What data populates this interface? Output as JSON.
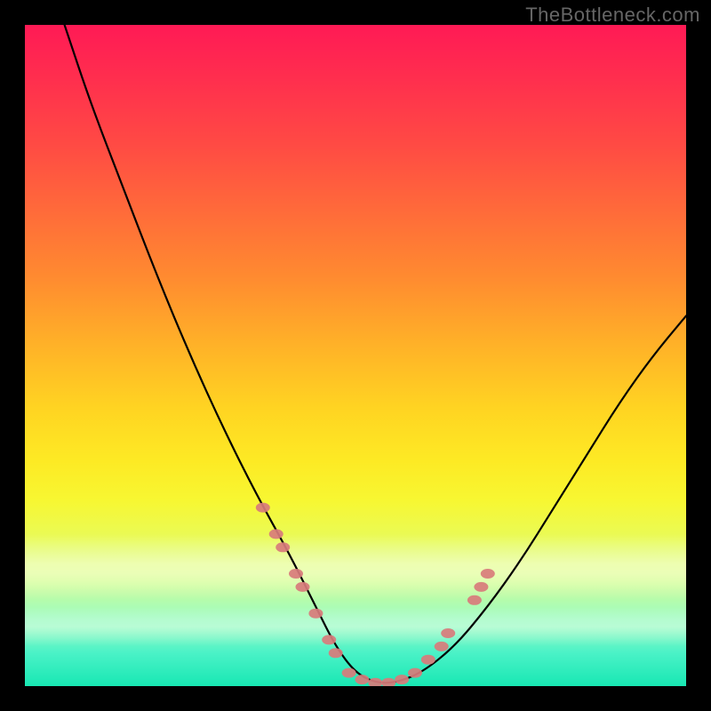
{
  "watermark": "TheBottleneck.com",
  "chart_data": {
    "type": "line",
    "title": "",
    "xlabel": "",
    "ylabel": "",
    "xlim": [
      0,
      100
    ],
    "ylim": [
      0,
      100
    ],
    "grid": false,
    "gradient_stops": [
      {
        "pos": 0.0,
        "color": "#ff1a55"
      },
      {
        "pos": 0.08,
        "color": "#ff2e4e"
      },
      {
        "pos": 0.18,
        "color": "#ff4a44"
      },
      {
        "pos": 0.28,
        "color": "#ff6a3a"
      },
      {
        "pos": 0.38,
        "color": "#ff8a30"
      },
      {
        "pos": 0.48,
        "color": "#ffb028"
      },
      {
        "pos": 0.58,
        "color": "#ffd422"
      },
      {
        "pos": 0.66,
        "color": "#fdea24"
      },
      {
        "pos": 0.72,
        "color": "#f7f732"
      },
      {
        "pos": 0.78,
        "color": "#e8fb5a"
      },
      {
        "pos": 0.84,
        "color": "#cdfd94"
      },
      {
        "pos": 0.9,
        "color": "#9cfbc4"
      },
      {
        "pos": 0.95,
        "color": "#4af2c7"
      },
      {
        "pos": 1.0,
        "color": "#18e7b3"
      }
    ],
    "series": [
      {
        "name": "bottleneck-curve",
        "color": "#000000",
        "x": [
          6,
          10,
          15,
          20,
          25,
          30,
          35,
          40,
          44,
          47,
          50,
          53,
          56,
          60,
          65,
          70,
          75,
          80,
          85,
          90,
          95,
          100
        ],
        "y": [
          100,
          88,
          75,
          62,
          50,
          39,
          29,
          20,
          12,
          6,
          2,
          0.5,
          0.5,
          2,
          6,
          12,
          19,
          27,
          35,
          43,
          50,
          56
        ]
      }
    ],
    "marker_overlays": [
      {
        "name": "pink-markers-left-arm",
        "color": "#d87b7b",
        "points": [
          {
            "x": 36,
            "y": 27
          },
          {
            "x": 38,
            "y": 23
          },
          {
            "x": 39,
            "y": 21
          },
          {
            "x": 41,
            "y": 17
          },
          {
            "x": 42,
            "y": 15
          },
          {
            "x": 44,
            "y": 11
          },
          {
            "x": 46,
            "y": 7
          },
          {
            "x": 47,
            "y": 5
          }
        ]
      },
      {
        "name": "pink-markers-bottom",
        "color": "#d87b7b",
        "points": [
          {
            "x": 49,
            "y": 2
          },
          {
            "x": 51,
            "y": 1
          },
          {
            "x": 53,
            "y": 0.5
          },
          {
            "x": 55,
            "y": 0.5
          },
          {
            "x": 57,
            "y": 1
          },
          {
            "x": 59,
            "y": 2
          }
        ]
      },
      {
        "name": "pink-markers-right-arm",
        "color": "#d87b7b",
        "points": [
          {
            "x": 61,
            "y": 4
          },
          {
            "x": 63,
            "y": 6
          },
          {
            "x": 64,
            "y": 8
          },
          {
            "x": 68,
            "y": 13
          },
          {
            "x": 69,
            "y": 15
          },
          {
            "x": 70,
            "y": 17
          }
        ]
      }
    ]
  }
}
